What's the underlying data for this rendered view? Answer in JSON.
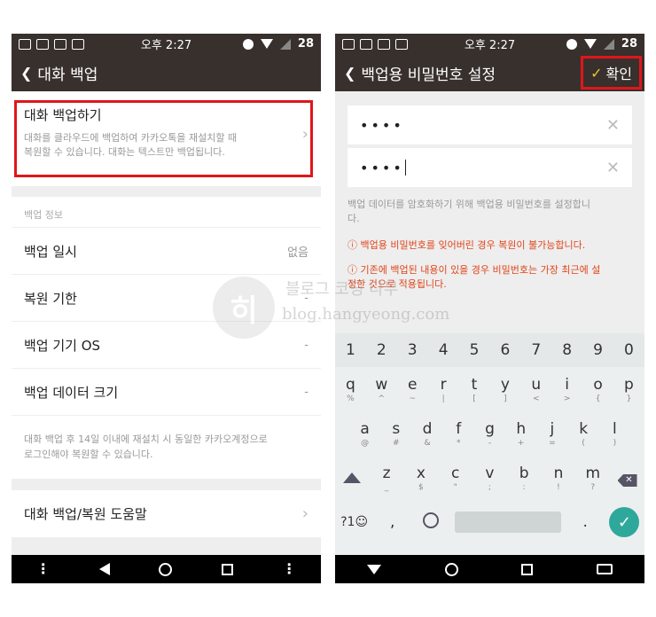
{
  "status": {
    "time_prefix": "오후 2:27",
    "battery": "28"
  },
  "left": {
    "title": "대화 백업",
    "backup_item": {
      "title": "대화 백업하기",
      "desc_line1": "대화를 클라우드에 백업하여 카카오톡을 재설치할 때",
      "desc_line2": "복원할 수 있습니다. 대화는 텍스트만 백업됩니다."
    },
    "section_label": "백업 정보",
    "rows": [
      {
        "label": "백업 일시",
        "value": "없음"
      },
      {
        "label": "복원 기한",
        "value": "-"
      },
      {
        "label": "백업 기기 OS",
        "value": "-"
      },
      {
        "label": "백업 데이터 크기",
        "value": "-"
      }
    ],
    "notice_line1": "대화 백업 후 14일 이내에 재설치 시 동일한 카카오계정으로",
    "notice_line2": "로그인해야 복원할 수 있습니다.",
    "help_item": "대화 백업/복원 도움말"
  },
  "right": {
    "title": "백업용 비밀번호 설정",
    "confirm": "확인",
    "password1": "••••",
    "password2": "••••",
    "desc": "백업 데이터를 암호화하기 위해 백업용 비밀번호를 설정합니다.",
    "desc_line1": "백업 데이터를 암호화하기 위해 백업용 비밀번호를 설정합니",
    "desc_line2": "다.",
    "warn1": "ⓘ 백업용 비밀번호를 잊어버린 경우 복원이 불가능합니다.",
    "warn2_line1": "ⓘ 기존에 백업된 내용이 있을 경우 비밀번호는 가장 최근에 설",
    "warn2_line2": "정한 것으로 적용됩니다."
  },
  "keyboard": {
    "numbers": [
      "1",
      "2",
      "3",
      "4",
      "5",
      "6",
      "7",
      "8",
      "9",
      "0"
    ],
    "row1": [
      [
        "q",
        "%"
      ],
      [
        "w",
        "^"
      ],
      [
        "e",
        "~"
      ],
      [
        "r",
        "|"
      ],
      [
        "t",
        "["
      ],
      [
        "y",
        "]"
      ],
      [
        "u",
        "<"
      ],
      [
        "i",
        ">"
      ],
      [
        "o",
        "{"
      ],
      [
        "p",
        "}"
      ]
    ],
    "row2": [
      [
        "a",
        "@"
      ],
      [
        "s",
        "#"
      ],
      [
        "d",
        "&"
      ],
      [
        "f",
        "*"
      ],
      [
        "g",
        "-"
      ],
      [
        "h",
        "+"
      ],
      [
        "j",
        "="
      ],
      [
        "k",
        "("
      ],
      [
        "l",
        ")"
      ]
    ],
    "row3": [
      [
        "z",
        "_"
      ],
      [
        "x",
        "$"
      ],
      [
        "c",
        "\""
      ],
      [
        "v",
        ";"
      ],
      [
        "b",
        ":"
      ],
      [
        "n",
        "!"
      ],
      [
        "m",
        "?"
      ]
    ],
    "symbols_key": "?1☺",
    "comma_key": ",",
    "period_key": "."
  },
  "watermark": {
    "line1": "블로그 코딩 나무",
    "line2": "blog.hangyeong.com",
    "logo_char": "히"
  },
  "colors": {
    "bar": "#38302d",
    "highlight": "#e0161b",
    "check": "#f2c230",
    "enter": "#2fa89c",
    "warn": "#e0451b"
  }
}
